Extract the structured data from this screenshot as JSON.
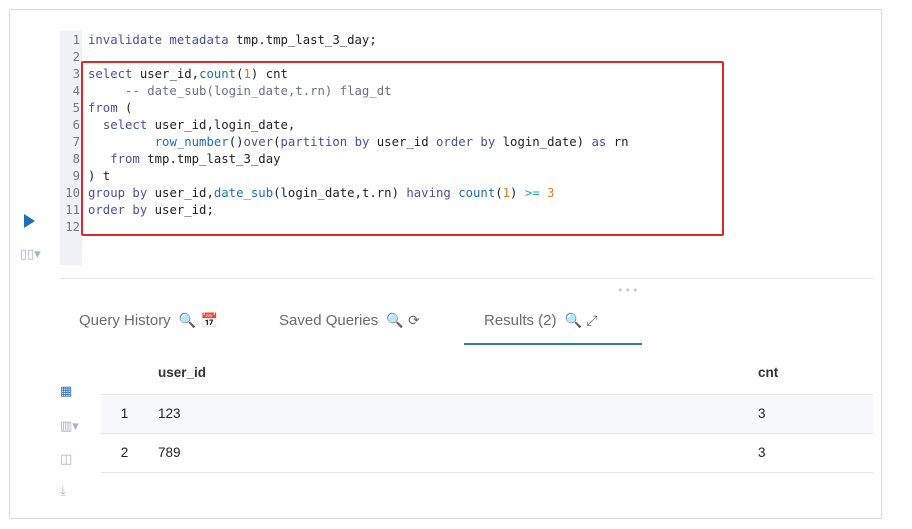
{
  "editor": {
    "lines": [
      {
        "n": "1",
        "tokens": [
          [
            "kw",
            "invalidate metadata"
          ],
          [
            "id",
            " tmp.tmp_last_3_day;"
          ]
        ]
      },
      {
        "n": "2",
        "tokens": []
      },
      {
        "n": "3",
        "tokens": [
          [
            "kw",
            "select"
          ],
          [
            "id",
            " user_id,"
          ],
          [
            "fn",
            "count"
          ],
          [
            "id",
            "("
          ],
          [
            "lit",
            "1"
          ],
          [
            "id",
            ") cnt"
          ]
        ]
      },
      {
        "n": "4",
        "tokens": [
          [
            "cm",
            "     -- date_sub(login_date,t.rn) flag_dt"
          ]
        ]
      },
      {
        "n": "5",
        "tokens": [
          [
            "kw",
            "from"
          ],
          [
            "id",
            " ("
          ]
        ]
      },
      {
        "n": "6",
        "tokens": [
          [
            "id",
            "  "
          ],
          [
            "kw",
            "select"
          ],
          [
            "id",
            " user_id,login_date,"
          ]
        ]
      },
      {
        "n": "7",
        "tokens": [
          [
            "id",
            "         "
          ],
          [
            "fn",
            "row_number"
          ],
          [
            "id",
            "()"
          ],
          [
            "kw",
            "over"
          ],
          [
            "id",
            "("
          ],
          [
            "kw",
            "partition by"
          ],
          [
            "id",
            " user_id "
          ],
          [
            "kw",
            "order by"
          ],
          [
            "id",
            " login_date) "
          ],
          [
            "kw",
            "as"
          ],
          [
            "id",
            " rn"
          ]
        ]
      },
      {
        "n": "8",
        "tokens": [
          [
            "id",
            "   "
          ],
          [
            "kw",
            "from"
          ],
          [
            "id",
            " tmp.tmp_last_3_day"
          ]
        ]
      },
      {
        "n": "9",
        "tokens": [
          [
            "id",
            ") t"
          ]
        ]
      },
      {
        "n": "10",
        "tokens": [
          [
            "kw",
            "group by"
          ],
          [
            "id",
            " user_id,"
          ],
          [
            "fn",
            "date_sub"
          ],
          [
            "id",
            "(login_date,t.rn) "
          ],
          [
            "kw",
            "having"
          ],
          [
            "id",
            " "
          ],
          [
            "fn",
            "count"
          ],
          [
            "id",
            "("
          ],
          [
            "lit",
            "1"
          ],
          [
            "id",
            ") "
          ],
          [
            "op",
            ">="
          ],
          [
            "id",
            " "
          ],
          [
            "lit",
            "3"
          ]
        ]
      },
      {
        "n": "11",
        "tokens": [
          [
            "kw",
            "order by"
          ],
          [
            "id",
            " user_id;"
          ]
        ]
      },
      {
        "n": "12",
        "tokens": []
      }
    ]
  },
  "icons": {
    "run": "play-icon",
    "snippets": "book-icon",
    "divider_dots": "•••"
  },
  "tabs": {
    "query_history": "Query History",
    "query_history_icons": "🔍 📅",
    "saved_queries": "Saved Queries",
    "saved_queries_icons": "🔍 ⟳",
    "results": "Results (2)",
    "results_icons": "🔍 ⤢"
  },
  "results": {
    "columns": [
      "",
      "user_id",
      "cnt"
    ],
    "rows": [
      [
        "1",
        "123",
        "3"
      ],
      [
        "2",
        "789",
        "3"
      ]
    ]
  },
  "colors": {
    "highlight_border": "#e0272a",
    "active_tab": "#2b7bc5",
    "run_button": "#1e6fb8"
  }
}
